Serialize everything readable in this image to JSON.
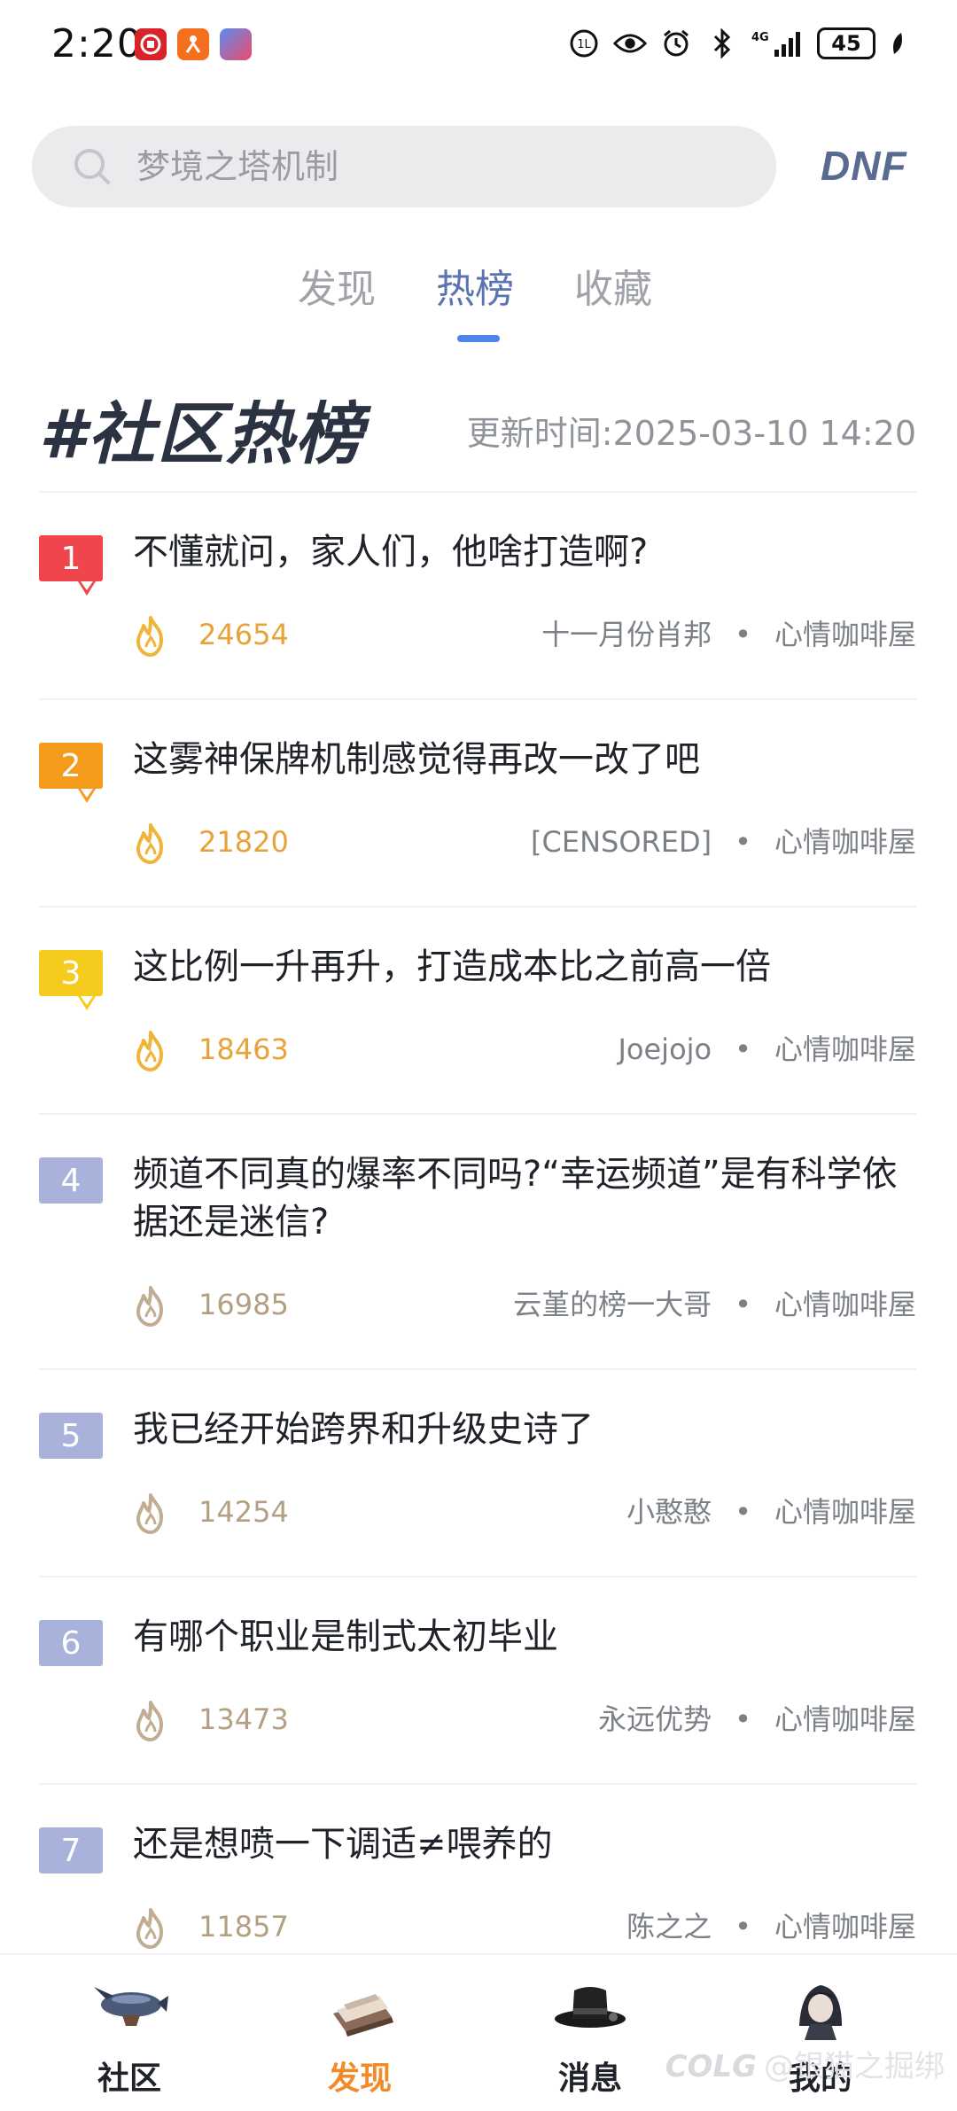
{
  "status_bar": {
    "time": "2:20",
    "battery": "45",
    "network": "4G"
  },
  "search": {
    "placeholder": "梦境之塔机制"
  },
  "brand": "DNF",
  "tabs": [
    {
      "label": "发现",
      "active": false
    },
    {
      "label": "热榜",
      "active": true
    },
    {
      "label": "收藏",
      "active": false
    }
  ],
  "board": {
    "title": "#社区热榜",
    "update_label": "更新时间:",
    "update_time": "2025-03-10 14:20"
  },
  "items": [
    {
      "rank": "1",
      "title": "不懂就问，家人们，他啥打造啊?",
      "heat": "24654",
      "author": "十一月份肖邦",
      "channel": "心情咖啡屋",
      "rank_color": "#f0454c"
    },
    {
      "rank": "2",
      "title": "这雾神保牌机制感觉得再改一改了吧",
      "heat": "21820",
      "author": "[CENSORED]",
      "channel": "心情咖啡屋",
      "rank_color": "#f59b1b"
    },
    {
      "rank": "3",
      "title": "这比例一升再升，打造成本比之前高一倍",
      "heat": "18463",
      "author": "Joejojo",
      "channel": "心情咖啡屋",
      "rank_color": "#f5cb1e"
    },
    {
      "rank": "4",
      "title": "频道不同真的爆率不同吗?“幸运频道”是有科学依据还是迷信?",
      "heat": "16985",
      "author": "云堇的榜一大哥",
      "channel": "心情咖啡屋",
      "rank_color": "#a9b2db"
    },
    {
      "rank": "5",
      "title": "我已经开始跨界和升级史诗了",
      "heat": "14254",
      "author": "小憨憨",
      "channel": "心情咖啡屋",
      "rank_color": "#a9b2db"
    },
    {
      "rank": "6",
      "title": "有哪个职业是制式太初毕业",
      "heat": "13473",
      "author": "永远优势",
      "channel": "心情咖啡屋",
      "rank_color": "#a9b2db"
    },
    {
      "rank": "7",
      "title": "还是想喷一下调适≠喂养的",
      "heat": "11857",
      "author": "陈之之",
      "channel": "心情咖啡屋",
      "rank_color": "#a9b2db"
    }
  ],
  "bottom_nav": [
    {
      "label": "社区",
      "icon": "airship-icon",
      "active": false
    },
    {
      "label": "发现",
      "icon": "book-icon",
      "active": true
    },
    {
      "label": "消息",
      "icon": "top-hat-icon",
      "active": false
    },
    {
      "label": "我的",
      "icon": "avatar-icon",
      "active": false
    }
  ],
  "watermark": "@银猫之掘绑",
  "watermark_logo": "COLG",
  "colors": {
    "accent_tab": "#5b73b2",
    "tab_indicator": "#4f83ec",
    "heat_hot": "#e7a23a",
    "nav_active": "#f28a28"
  }
}
